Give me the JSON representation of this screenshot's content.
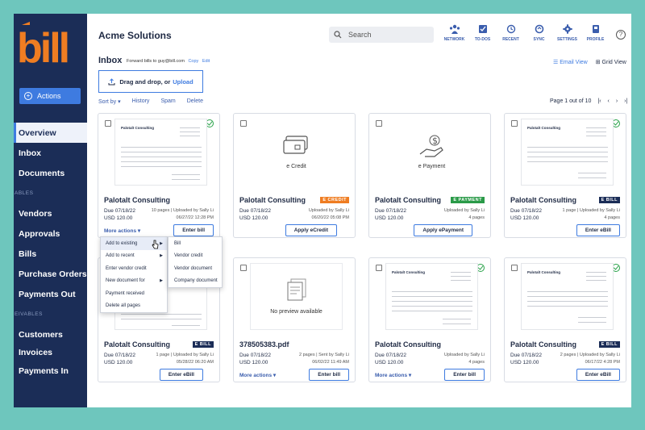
{
  "brand": {
    "logo_text": "bill",
    "logo_color": "#ef7d22",
    "sidebar_color": "#1b2d57",
    "accent": "#3e7be0"
  },
  "sidebar": {
    "actions_label": "Actions",
    "items": [
      {
        "label": "Overview",
        "active": true
      },
      {
        "label": "Inbox"
      },
      {
        "label": "Documents"
      }
    ],
    "section1": "ABLES",
    "items2": [
      {
        "label": "Vendors"
      },
      {
        "label": "Approvals"
      },
      {
        "label": "Bills"
      },
      {
        "label": "Purchase Orders"
      },
      {
        "label": "Payments Out"
      }
    ],
    "section2": "EIVABLES",
    "items3": [
      {
        "label": "Customers"
      },
      {
        "label": "Invoices"
      },
      {
        "label": "Payments In"
      }
    ]
  },
  "header": {
    "company": "Acme Solutions",
    "search_placeholder": "Search",
    "icons": [
      {
        "label": "NETWORK",
        "icon": "network-icon"
      },
      {
        "label": "TO-DOS",
        "icon": "todos-icon"
      },
      {
        "label": "RECENT",
        "icon": "recent-icon"
      },
      {
        "label": "SYNC",
        "icon": "sync-icon"
      },
      {
        "label": "SETTINGS",
        "icon": "settings-icon"
      },
      {
        "label": "PROFILE",
        "icon": "profile-icon"
      }
    ],
    "help": "?"
  },
  "inbox": {
    "title": "Inbox",
    "forward_text": "Forward bills to guy@bill.com",
    "copy": "Copy",
    "edit": "Edit",
    "email_view": "Email View",
    "grid_view": "Grid View",
    "drop_text": "Drag and drop, or",
    "upload": "Upload",
    "sort": "Sort by",
    "history": "History",
    "spam": "Spam",
    "delete": "Delete",
    "page_info": "Page 1 out of 10"
  },
  "cards": [
    {
      "name": "Palotalt Consulting",
      "due": "Due 07/18/22",
      "amount": "USD 120.00",
      "pages": "10 pages",
      "uploaded": "Uploaded by Sally Li",
      "date": "06/27/22  12:28 PM",
      "more": "More actions",
      "button": "Enter bill",
      "doc_title": "Palotalt Consulting"
    },
    {
      "name": "Palotalt Consulting",
      "badge": "E CREDIT",
      "due": "Due 07/18/22",
      "amount": "USD 120.00",
      "uploaded": "Uploaded by Sally Li",
      "date": "06/20/22  05:08 PM",
      "button": "Apply eCredit",
      "thumb_label": "e Credit"
    },
    {
      "name": "Palotalt Consulting",
      "badge": "E PAYMENT",
      "due": "Due 07/18/22",
      "amount": "USD 120.00",
      "uploaded": "Uploaded by Sally Li",
      "date": "4 pages",
      "button": "Apply ePayment",
      "thumb_label": "e Payment"
    },
    {
      "name": "Palotalt Consulting",
      "badge": "E BILL",
      "due": "Due 07/18/22",
      "amount": "USD 120.00",
      "pages": "1 page",
      "uploaded": "Uploaded by Sally Li",
      "date": "4 pages",
      "button": "Enter eBill",
      "doc_title": "Palotalt Consulting"
    },
    {
      "name": "Palotalt Consulting",
      "badge": "E BILL",
      "due": "Due 07/18/22",
      "amount": "USD 120.00",
      "pages": "1 page",
      "uploaded": "Uploaded by Sally Li",
      "date": "05/28/22  06:20 AM",
      "button": "Enter eBill"
    },
    {
      "name": "378505383.pdf",
      "due": "Due 07/18/22",
      "amount": "USD 120.00",
      "pages": "2 pages",
      "uploaded": "Sent by Sally Li",
      "date": "06/02/22  11:49 AM",
      "more": "More actions",
      "button": "Enter bill",
      "thumb_label": "No preview available"
    },
    {
      "name": "Palotalt Consulting",
      "due": "Due 07/18/22",
      "amount": "USD 120.00",
      "uploaded": "Uploaded by Sally Li",
      "date": "4 pages",
      "more": "More actions",
      "button": "Enter bill",
      "doc_title": "Palotalt Consulting"
    },
    {
      "name": "Palotalt Consulting",
      "badge": "E BILL",
      "due": "Due 07/18/22",
      "amount": "USD 120.00",
      "pages": "2 pages",
      "uploaded": "Uploaded by Sally Li",
      "date": "06/17/22  4:28 PM",
      "button": "Enter eBill",
      "doc_title": "Palotalt Consulting"
    }
  ],
  "menu": {
    "items": [
      "Add to existing",
      "Add to recent",
      "Enter vendor credit",
      "New document for",
      "Payment received",
      "Delete all pages"
    ],
    "submenu": [
      "Bill",
      "Vendor credit",
      "Vendor document",
      "Company document"
    ]
  }
}
